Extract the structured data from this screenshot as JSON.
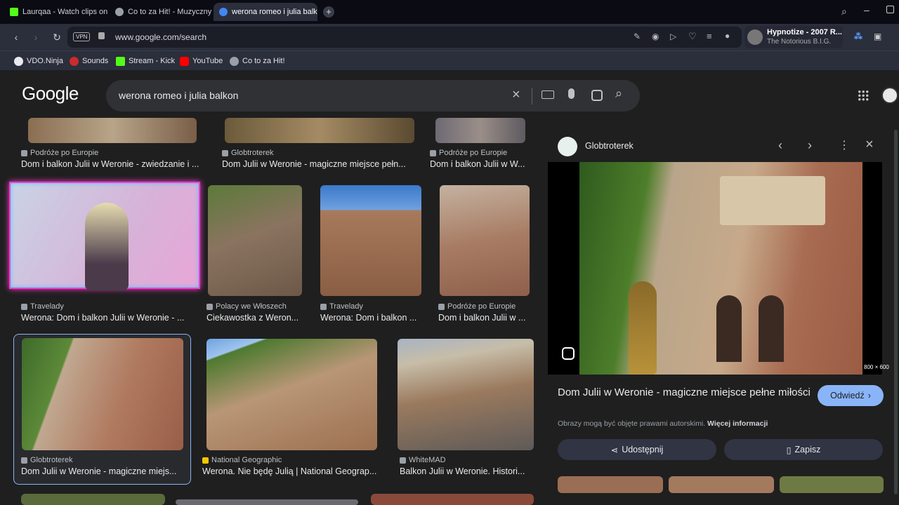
{
  "tabs": [
    {
      "label": "Laurqaa - Watch clips on K",
      "favicon_color": "#53fc18"
    },
    {
      "label": "Co to za Hit! - Muzyczny Q",
      "favicon_color": "#9aa0a6"
    },
    {
      "label": "werona romeo i julia balko",
      "favicon_color": "#4285f4",
      "active": true
    }
  ],
  "nav": {
    "vpn_label": "VPN",
    "url": "www.google.com/search"
  },
  "media": {
    "title": "Hypnotize - 2007 R...",
    "artist": "The Notorious B.I.G."
  },
  "bookmarks": [
    {
      "label": "VDO.Ninja",
      "color": "#e8eaed"
    },
    {
      "label": "Sounds",
      "color": "#cc2b2b"
    },
    {
      "label": "Stream - Kick",
      "color": "#53fc18"
    },
    {
      "label": "YouTube",
      "color": "#ff0000"
    },
    {
      "label": "Co to za Hit!",
      "color": "#9aa0a6"
    }
  ],
  "google": {
    "logo": "Google",
    "query": "werona romeo i julia balkon"
  },
  "results_row1": [
    {
      "source": "Podróże po Europie",
      "title": "Dom i balkon Julii w Weronie - zwiedzanie i ..."
    },
    {
      "source": "Globtroterek",
      "title": "Dom Julii w Weronie - magiczne miejsce pełn..."
    },
    {
      "source": "Podróże po Europie",
      "title": "Dom i balkon Julii w W..."
    }
  ],
  "results_row2": [
    {
      "source": "Travelady",
      "title": "Werona: Dom i balkon Julii w Weronie - ..."
    },
    {
      "source": "Polacy we Włoszech",
      "title": "Ciekawostka z Weron..."
    },
    {
      "source": "Travelady",
      "title": "Werona: Dom i balkon ..."
    },
    {
      "source": "Podróże po Europie",
      "title": "Dom i balkon Julii w ..."
    }
  ],
  "results_row3": [
    {
      "source": "Globtroterek",
      "title": "Dom Julii w Weronie - magiczne miejs..."
    },
    {
      "source": "National Geographic",
      "title": "Werona. Nie będę Julią | National Geograp..."
    },
    {
      "source": "WhiteMAD",
      "title": "Balkon Julii w Weronie. Histori..."
    }
  ],
  "panel": {
    "site": "Globtroterek",
    "dimensions": "800 × 600",
    "title": "Dom Julii w Weronie - magiczne miejsce pełne miłości",
    "visit_label": "Odwiedź",
    "copyright_text": "Obrazy mogą być objęte prawami autorskimi.",
    "more_info": "Więcej informacji",
    "share_label": "Udostępnij",
    "save_label": "Zapisz"
  }
}
